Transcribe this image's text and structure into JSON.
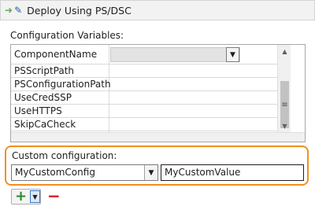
{
  "titlebar": {
    "title": "Deploy Using PS/DSC"
  },
  "configuration_variables": {
    "label": "Configuration Variables:",
    "rows": [
      {
        "name": "ComponentName"
      },
      {
        "name": "PSScriptPath"
      },
      {
        "name": "PSConfigurationPath"
      },
      {
        "name": "UseCredSSP"
      },
      {
        "name": "UseHTTPS"
      },
      {
        "name": "SkipCaCheck"
      }
    ]
  },
  "custom_configuration": {
    "label": "Custom configuration:",
    "name_value": "MyCustomConfig",
    "value_value": "MyCustomValue"
  },
  "colors": {
    "highlight_border": "#f0901e",
    "add_icon": "#2a8a2a",
    "remove_icon": "#d71920"
  },
  "icons": {
    "titlebar": [
      "arrow-icon",
      "pencil-icon"
    ],
    "add": "plus-icon",
    "remove": "minus-icon"
  }
}
